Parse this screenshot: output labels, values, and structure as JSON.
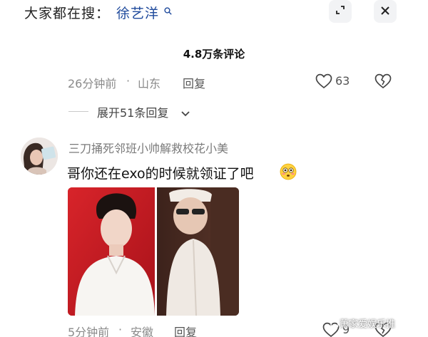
{
  "search": {
    "prefix": "大家都在搜：",
    "term": "徐艺洋",
    "search_icon": "search-icon"
  },
  "header": {
    "shrink_icon": "shrink-icon",
    "close_icon": "close-icon",
    "comment_count": "4.8万条评论"
  },
  "comments": [
    {
      "time": "26分钟前",
      "location": "山东",
      "reply_label": "回复",
      "likes": "63",
      "expand_label": "展开51条回复"
    },
    {
      "username": "三刀捅死邻班小帅解救校花小美",
      "text": "哥你还在exo的时候就领证了吧",
      "emoji": "flushed-face-emoji",
      "time": "5分钟前",
      "location": "安徽",
      "reply_label": "回复",
      "likes": "9"
    }
  ],
  "watermark": "萧家爱娱乐推",
  "colors": {
    "accent_link": "#1f4a9c",
    "meta_gray": "#8a8a8a",
    "photo_bg_red": "#c81a1e"
  }
}
